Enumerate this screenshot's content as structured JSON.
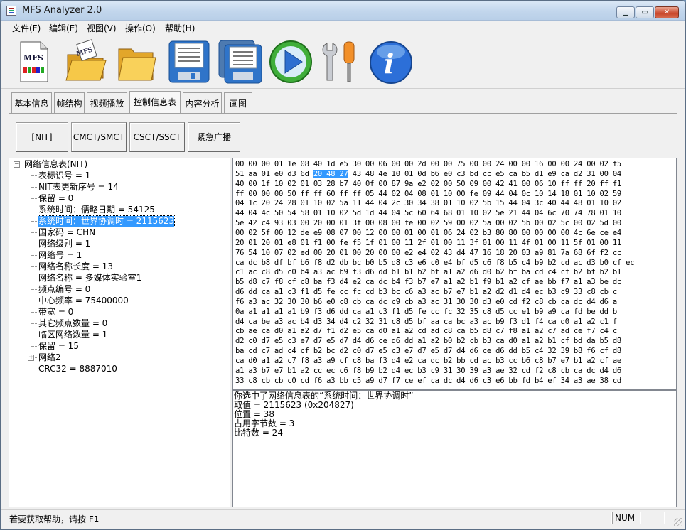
{
  "window": {
    "title": "MFS Analyzer 2.0"
  },
  "menu": [
    "文件(F)",
    "编辑(E)",
    "视图(V)",
    "操作(O)",
    "帮助(H)"
  ],
  "toolbar": {
    "logo_text": "MFS",
    "items": [
      "mfs-file-icon",
      "open-mfs-folder-icon",
      "open-folder-icon",
      "save-icon",
      "save-all-icon",
      "play-icon",
      "settings-tools-icon",
      "info-icon"
    ]
  },
  "tabs": [
    "基本信息",
    "帧结构",
    "视频播放",
    "控制信息表",
    "内容分析",
    "画图"
  ],
  "subtabs": [
    "[NIT]",
    "CMCT/SMCT",
    "CSCT/SSCT",
    "紧急广播"
  ],
  "tree": {
    "root": "网络信息表(NIT)",
    "items": [
      "表标识号 = 1",
      "NIT表更新序号 = 14",
      "保留 = 0",
      "系统时间：儒略日期 = 54125",
      "系统时间：世界协调时 = 2115623",
      "国家码 = CHN",
      "网络级别 = 1",
      "网络号 = 1",
      "网络名称长度 = 13",
      "网络名称 = 多媒体实验室1",
      "频点编号 = 0",
      "中心频率 = 75400000",
      "带宽 = 0",
      "其它频点数量 = 0",
      "临区网络数量 = 1",
      "保留 = 15",
      "网络2",
      "CRC32 = 8887010"
    ]
  },
  "hex_rows": [
    "00 00 00 01 1e 08 40 1d e5 30 00 06 00 00 2d 00 00 75 00 00 24 00 00 16 00 00 24 00 02 f5",
    "51 aa 01 e0 d3 6d |20 48 27| 43 48 4e 10 01 0d b6 e0 c3 bd cc e5 ca b5 d1 e9 ca d2 31 00 04",
    "40 00 1f 10 02 01 03 28 b7 40 0f 00 87 9a e2 02 00 50 09 00 42 41 00 06 10 ff ff 20 ff f1",
    "ff 00 00 00 50 ff ff 60 ff ff 05 44 02 04 08 01 10 00 fe 09 44 04 0c 10 14 18 01 10 02 59",
    "04 1c 20 24 28 01 10 02 5a 11 44 04 2c 30 34 38 01 10 02 5b 15 44 04 3c 40 44 48 01 10 02",
    "44 04 4c 50 54 58 01 10 02 5d 1d 44 04 5c 60 64 68 01 10 02 5e 21 44 04 6c 70 74 78 01 10",
    "5e 42 c4 93 03 00 20 00 01 3f 00 08 00 fe 00 02 59 00 02 5a 00 02 5b 00 02 5c 00 02 5d 00",
    "00 02 5f 00 12 de e9 08 07 00 12 00 00 01 00 01 06 24 02 b3 80 80 00 00 00 00 4c 6e ce e4",
    "20 01 20 01 e8 01 f1 00 fe f5 1f 01 00 11 2f 01 00 11 3f 01 00 11 4f 01 00 11 5f 01 00 11",
    "76 54 10 07 02 ed 00 20 01 00 20 00 00 e2 e4 02 43 d4 47 16 18 20 03 a9 81 7a 68 6f f2 cc",
    "ca dc b8 df bf b6 f8 d2 db bc b0 b5 d8 c3 e6 c0 e4 bf d5 c6 f8 b5 c4 b9 b2 cd ac d3 b0 cf ec",
    "c1 ac c8 d5 c0 b4 a3 ac b9 f3 d6 dd b1 b1 b2 bf a1 a2 d6 d0 b2 bf ba cd c4 cf b2 bf b2 b1",
    "b5 d8 c7 f8 cf c8 ba f3 d4 e2 ca dc b4 f3 b7 e7 a1 a2 b1 f9 b1 a2 cf ae bb f7 a1 a3 be dc",
    "d6 dd ca a1 c3 f1 d5 fe cc fc cd b3 bc c6 a3 ac b7 e7 b1 a2 d2 d1 d4 ec b3 c9 33 c8 cb c",
    "f6 a3 ac 32 30 30 b6 e0 c8 cb ca dc c9 cb a3 ac 31 30 30 d3 e0 cd f2 c8 cb ca dc d4 d6 a",
    "0a a1 a1 a1 a1 b9 f3 d6 dd ca a1 c3 f1 d5 fe cc fc 32 35 c8 d5 cc e1 b9 a9 ca fd be dd b",
    "d4 ca be a3 ac b4 d3 34 d4 c2 32 31 c8 d5 bf aa ca bc a3 ac b9 f3 d1 f4 ca d0 a1 a2 c1 f",
    "cb ae ca d0 a1 a2 d7 f1 d2 e5 ca d0 a1 a2 cd ad c8 ca b5 d8 c7 f8 a1 a2 c7 ad ce f7 c4 c",
    "d2 c0 d7 e5 c3 e7 d7 e5 d7 d4 d6 ce d6 dd a1 a2 b0 b2 cb b3 ca d0 a1 a2 b1 cf bd da b5 d8",
    "ba cd c7 ad c4 cf b2 bc d2 c0 d7 e5 c3 e7 d7 e5 d7 d4 d6 ce d6 dd b5 c4 32 39 b8 f6 cf d8",
    "ca d0 a1 a2 c7 f8 a3 a9 cf c8 ba f3 d4 e2 ca dc b2 bb cd ac b3 cc b6 c8 b7 e7 b1 a2 cf ae",
    "a1 a3 b7 e7 b1 a2 cc ec c6 f8 b9 b2 d4 ec b3 c9 31 30 39 a3 ae 32 cd f2 c8 cb ca dc d4 d6",
    "33 c8 cb cb c0 cd f6 a3 bb c5 a9 d7 f7 ce ef ca dc d4 d6 c3 e6 bb fd b4 ef 34 a3 ae 38 cd"
  ],
  "info": [
    "你选中了网络信息表的“系统时间：世界协调时”",
    "取值 = 2115623 (0x204827)",
    "位置 = 38",
    "占用字节数 = 3",
    "比特数 = 24"
  ],
  "status": {
    "text": "若要获取帮助，请按 F1",
    "num": "NUM"
  }
}
